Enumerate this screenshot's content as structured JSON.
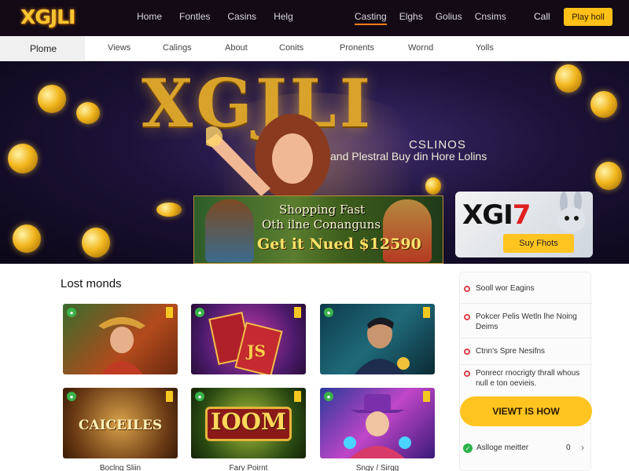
{
  "brand": {
    "logo": "XGJLI"
  },
  "topnav": {
    "left": [
      "Home",
      "Fontles",
      "Casins",
      "Helg"
    ],
    "right": [
      "Casting",
      "Elghs",
      "Golius",
      "Cnsims"
    ],
    "call": "Call",
    "play_button": "Play holl"
  },
  "subnav": {
    "home": "Plome",
    "items": [
      "Views",
      "Calings",
      "About",
      "Conits",
      "Pronents",
      "Wornd",
      "Yolls"
    ]
  },
  "hero": {
    "title": "XGJLI",
    "subtitle_brand": "CSLINOS",
    "subtitle": "and Plestral Buy din Hore Lolins",
    "promo_line1": "Shopping Fast",
    "promo_line2": "Oth ilne Conanguns",
    "promo_line3": "Get it Nued $12590",
    "side_banner_title_a": "XGI",
    "side_banner_title_b": "7",
    "side_banner_button": "Suy Fhots"
  },
  "main": {
    "section_title": "Lost monds",
    "cards": [
      {
        "label": "",
        "caption": ""
      },
      {
        "label": "JS",
        "caption": ""
      },
      {
        "label": "",
        "caption": ""
      },
      {
        "label": "CAICEILES",
        "caption": "Boclng Sliin"
      },
      {
        "label": "IOOM",
        "caption": "Fary Poirnt"
      },
      {
        "label": "",
        "caption": "Sngy / Sirgg"
      }
    ]
  },
  "sidebar": {
    "items": [
      "Sooll wor Eagins",
      "Pokcer Pelis Wetln lhe Noing Deims",
      "Ctnn's Spre Nesifns",
      "Ponrecr rnocrigty thrall whous null e ton oevieis."
    ],
    "cta": "VIEWT IS HOW",
    "footer_label": "Aslloge meitter",
    "footer_count": "0",
    "footer_arrow": "›"
  },
  "colors": {
    "accent_yellow": "#ffc018",
    "topbar": "#130a16",
    "status_green": "#2ab34a",
    "status_red": "#e0404a"
  }
}
